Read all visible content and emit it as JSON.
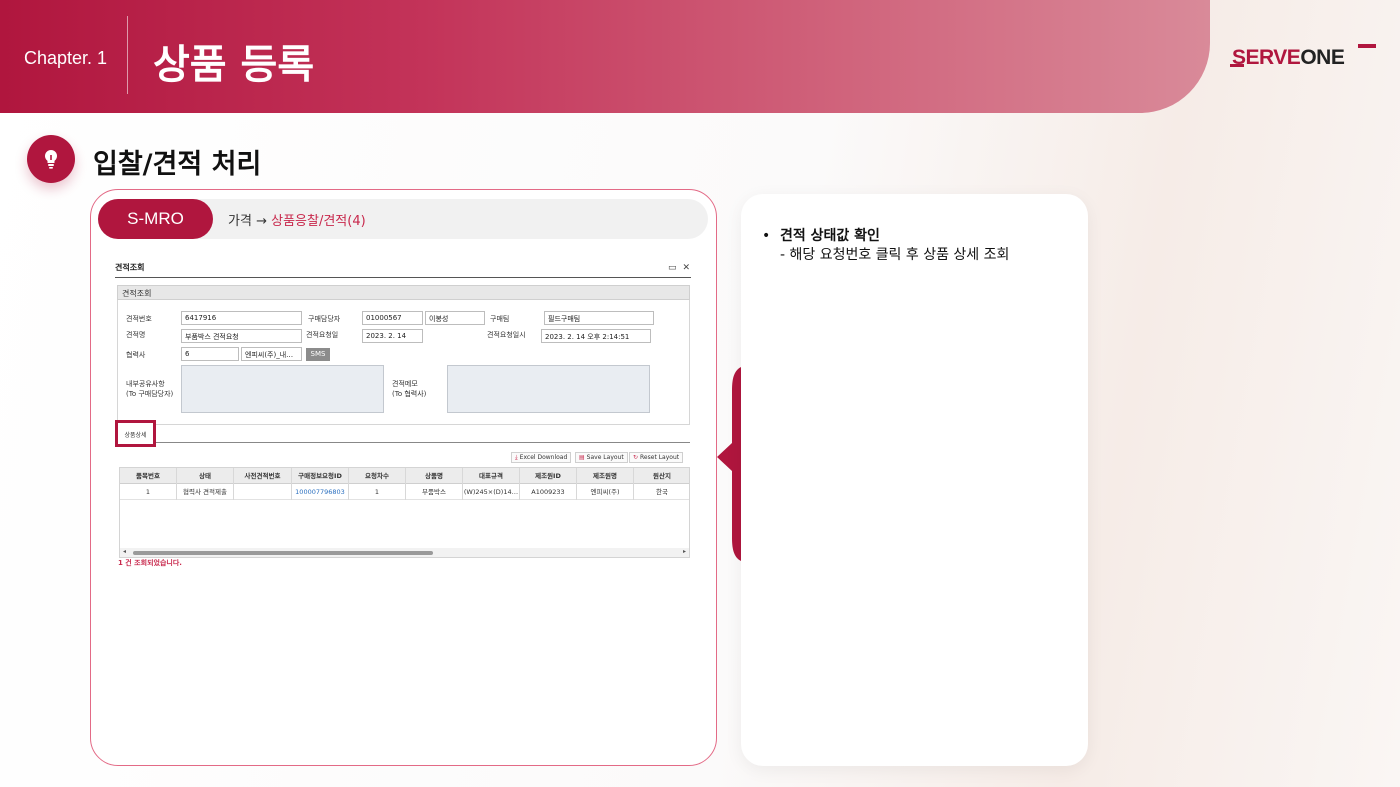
{
  "header": {
    "chapter": "Chapter. 1",
    "title": "상품 등록",
    "logo_serve": "SERVE",
    "logo_one": "ONE"
  },
  "section": {
    "title": "입찰/견적 처리"
  },
  "nav": {
    "system": "S-MRO",
    "path_prefix": "가격",
    "arrow": "→",
    "path_active": "상품응찰/견적(4)"
  },
  "erp": {
    "window_title": "견적조회",
    "section_title": "견적조회",
    "fields": {
      "quote_no_label": "견적번호",
      "quote_no": "6417916",
      "buyer_label": "구매담당자",
      "buyer_id": "01000567",
      "buyer_name": "이봉성",
      "team_label": "구매팀",
      "team": "필드구매팀",
      "quote_name_label": "견적명",
      "quote_name": "부품박스 견적요청",
      "request_date_label": "견적요청일",
      "request_date": "2023. 2. 14",
      "request_datetime_label": "견적요청일시",
      "request_datetime": "2023. 2. 14 오후 2:14:51",
      "partner_label": "협력사",
      "partner_code": "6",
      "partner_name": "엔피씨(주)_내…",
      "sms": "SMS",
      "internal_label_1": "내부공유사항",
      "internal_label_2": "(To 구매담당자)",
      "memo_label_1": "견적메모",
      "memo_label_2": "(To 협력사)"
    },
    "tab": "상품상세",
    "toolbar": {
      "excel": "Excel Download",
      "save_layout": "Save Layout",
      "reset_layout": "Reset Layout"
    },
    "columns": [
      "품목번호",
      "상태",
      "사전견적번호",
      "구매정보요청ID",
      "요청차수",
      "상품명",
      "대표규격",
      "제조원ID",
      "제조원명",
      "원산지"
    ],
    "rows": [
      [
        "1",
        "협력사 견적제출",
        "",
        "100007796803",
        "1",
        "부품박스",
        "(W)245×(D)14…",
        "A1009233",
        "엔피씨(주)",
        "한국"
      ]
    ],
    "result": "1 건 조회되었습니다."
  },
  "note": {
    "bullet": "•",
    "title": "견적 상태값 확인",
    "desc": "- 해당 요청번호 클릭 후 상품 상세 조회"
  },
  "colors": {
    "brand": "#b0163e",
    "accent_text": "#c8284c"
  }
}
